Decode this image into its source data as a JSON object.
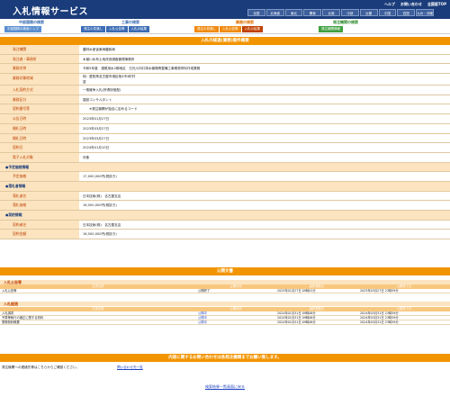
{
  "header": {
    "title": "入札情報サービス",
    "links": [
      "ヘルプ",
      "お問い合わせ",
      "全国版TOP"
    ],
    "regions": [
      "全国",
      "北海道",
      "東北",
      "関東",
      "北陸",
      "中部",
      "近畿",
      "中国",
      "四国",
      "九州・沖縄"
    ]
  },
  "nav": {
    "groups": [
      {
        "title": "中部国際の検索",
        "buttons": [
          "中部国際の検索トップ"
        ]
      },
      {
        "title": "工事の検索",
        "buttons": [
          "発注の見通し",
          "入札公告等",
          "入札の結果"
        ]
      },
      {
        "title": "業務の検索",
        "buttons": [
          "発注の見通し",
          "入札公告等",
          "入札の結果"
        ],
        "active_index": 2
      },
      {
        "title": "発注機関の検索",
        "buttons": [
          "発注機関情報"
        ]
      }
    ]
  },
  "detail": {
    "title": "入札の経過(業務)案件概要",
    "rows": [
      {
        "label": "発注機関",
        "value": "農林水産省東海農政局"
      },
      {
        "label": "発注者・事務所",
        "value": "木曽川水系土地改良調査管理事務所"
      },
      {
        "label": "業務名称",
        "value": "令和5年度　濃尾用水2期地区　日光川河口排水機場等整備工事積算資料作成業務"
      },
      {
        "label": "業務対象地域",
        "value": "他：愛知県名古屋市港区他4市3町村",
        "value2": "富",
        "tall": true
      },
      {
        "label": "入札契約方式",
        "value": "一般競争入札(所得評価型)"
      },
      {
        "label": "業務区分",
        "value": "建設コンサルタント"
      },
      {
        "label": "契約番号等",
        "value": "　　※発注機関が独自に定めるコード"
      },
      {
        "label": "公告日時",
        "value": "2023年01月27日"
      },
      {
        "label": "開札日時",
        "value": "2023年03月27日"
      },
      {
        "label": "開札日時",
        "value": "2023年03月27日"
      },
      {
        "label": "契約日",
        "value": "2024年01月10日"
      },
      {
        "label": "電子入札対象",
        "value": "対象"
      },
      {
        "label": "●予定価格情報",
        "sub": true
      },
      {
        "label": "予定価格",
        "value": "17,000,000円(税抜き)"
      },
      {
        "label": "●落札者情報",
        "sub": true
      },
      {
        "label": "落札者名",
        "value": "日本技術(株)　名古屋支店"
      },
      {
        "label": "落札価格",
        "value": "16,500,000円(税抜き)"
      },
      {
        "label": "●契約情報",
        "sub": true
      },
      {
        "label": "契約者名",
        "value": "日本技術(株)　名古屋支店"
      },
      {
        "label": "契約金額",
        "value": "16,500,000円(税抜き)"
      }
    ]
  },
  "docs": {
    "title": "公開文書",
    "columns": [
      "文書名称",
      "公開状況",
      "最終更新日",
      "公開終了日"
    ],
    "notice": {
      "title": "入札公告等",
      "rows": [
        [
          "入札公告等",
          "公開終了",
          "2023年01月27日 09時01分",
          "2023年03月27日 23時59分"
        ]
      ]
    },
    "result": {
      "title": "入札経過",
      "rows": [
        [
          "入札調書",
          "公開中",
          "2024年01月31日 09時06分",
          "2024年03月31日 23時59分"
        ],
        [
          "予算等執行の適正に関する資料",
          "公開中",
          "2024年01月31日 09時06分",
          "2024年03月31日 23時59分"
        ],
        [
          "業務契約概要",
          "公開中",
          "2024年01月31日 09時06分",
          "2024年03月31日 23時59分"
        ]
      ]
    }
  },
  "contact": {
    "title": "内容に関するお問い合わせは各発注機関までお願い致します。",
    "note": "発注機関への連絡先等はこちらからご確認ください。",
    "link": "問い合わせ先一覧"
  },
  "back": "検索結果一覧画面に戻る"
}
